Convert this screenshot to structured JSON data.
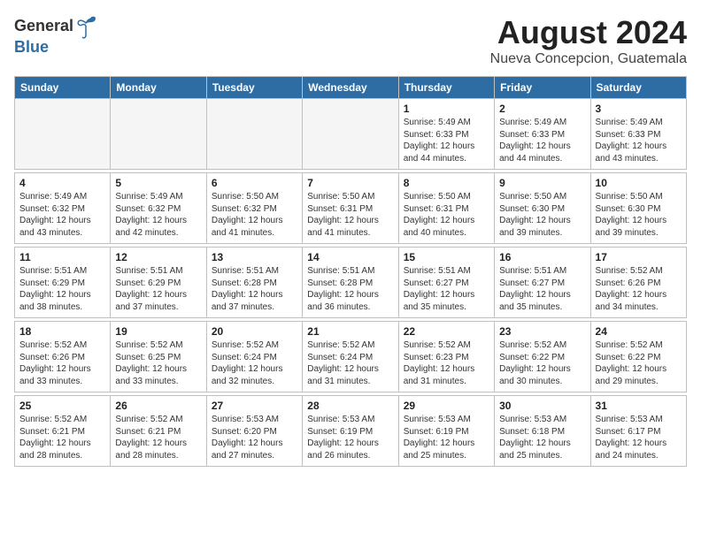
{
  "header": {
    "logo_general": "General",
    "logo_blue": "Blue",
    "month_year": "August 2024",
    "location": "Nueva Concepcion, Guatemala"
  },
  "days_of_week": [
    "Sunday",
    "Monday",
    "Tuesday",
    "Wednesday",
    "Thursday",
    "Friday",
    "Saturday"
  ],
  "weeks": [
    [
      {
        "day": "",
        "info": ""
      },
      {
        "day": "",
        "info": ""
      },
      {
        "day": "",
        "info": ""
      },
      {
        "day": "",
        "info": ""
      },
      {
        "day": "1",
        "info": "Sunrise: 5:49 AM\nSunset: 6:33 PM\nDaylight: 12 hours\nand 44 minutes."
      },
      {
        "day": "2",
        "info": "Sunrise: 5:49 AM\nSunset: 6:33 PM\nDaylight: 12 hours\nand 44 minutes."
      },
      {
        "day": "3",
        "info": "Sunrise: 5:49 AM\nSunset: 6:33 PM\nDaylight: 12 hours\nand 43 minutes."
      }
    ],
    [
      {
        "day": "4",
        "info": "Sunrise: 5:49 AM\nSunset: 6:32 PM\nDaylight: 12 hours\nand 43 minutes."
      },
      {
        "day": "5",
        "info": "Sunrise: 5:49 AM\nSunset: 6:32 PM\nDaylight: 12 hours\nand 42 minutes."
      },
      {
        "day": "6",
        "info": "Sunrise: 5:50 AM\nSunset: 6:32 PM\nDaylight: 12 hours\nand 41 minutes."
      },
      {
        "day": "7",
        "info": "Sunrise: 5:50 AM\nSunset: 6:31 PM\nDaylight: 12 hours\nand 41 minutes."
      },
      {
        "day": "8",
        "info": "Sunrise: 5:50 AM\nSunset: 6:31 PM\nDaylight: 12 hours\nand 40 minutes."
      },
      {
        "day": "9",
        "info": "Sunrise: 5:50 AM\nSunset: 6:30 PM\nDaylight: 12 hours\nand 39 minutes."
      },
      {
        "day": "10",
        "info": "Sunrise: 5:50 AM\nSunset: 6:30 PM\nDaylight: 12 hours\nand 39 minutes."
      }
    ],
    [
      {
        "day": "11",
        "info": "Sunrise: 5:51 AM\nSunset: 6:29 PM\nDaylight: 12 hours\nand 38 minutes."
      },
      {
        "day": "12",
        "info": "Sunrise: 5:51 AM\nSunset: 6:29 PM\nDaylight: 12 hours\nand 37 minutes."
      },
      {
        "day": "13",
        "info": "Sunrise: 5:51 AM\nSunset: 6:28 PM\nDaylight: 12 hours\nand 37 minutes."
      },
      {
        "day": "14",
        "info": "Sunrise: 5:51 AM\nSunset: 6:28 PM\nDaylight: 12 hours\nand 36 minutes."
      },
      {
        "day": "15",
        "info": "Sunrise: 5:51 AM\nSunset: 6:27 PM\nDaylight: 12 hours\nand 35 minutes."
      },
      {
        "day": "16",
        "info": "Sunrise: 5:51 AM\nSunset: 6:27 PM\nDaylight: 12 hours\nand 35 minutes."
      },
      {
        "day": "17",
        "info": "Sunrise: 5:52 AM\nSunset: 6:26 PM\nDaylight: 12 hours\nand 34 minutes."
      }
    ],
    [
      {
        "day": "18",
        "info": "Sunrise: 5:52 AM\nSunset: 6:26 PM\nDaylight: 12 hours\nand 33 minutes."
      },
      {
        "day": "19",
        "info": "Sunrise: 5:52 AM\nSunset: 6:25 PM\nDaylight: 12 hours\nand 33 minutes."
      },
      {
        "day": "20",
        "info": "Sunrise: 5:52 AM\nSunset: 6:24 PM\nDaylight: 12 hours\nand 32 minutes."
      },
      {
        "day": "21",
        "info": "Sunrise: 5:52 AM\nSunset: 6:24 PM\nDaylight: 12 hours\nand 31 minutes."
      },
      {
        "day": "22",
        "info": "Sunrise: 5:52 AM\nSunset: 6:23 PM\nDaylight: 12 hours\nand 31 minutes."
      },
      {
        "day": "23",
        "info": "Sunrise: 5:52 AM\nSunset: 6:22 PM\nDaylight: 12 hours\nand 30 minutes."
      },
      {
        "day": "24",
        "info": "Sunrise: 5:52 AM\nSunset: 6:22 PM\nDaylight: 12 hours\nand 29 minutes."
      }
    ],
    [
      {
        "day": "25",
        "info": "Sunrise: 5:52 AM\nSunset: 6:21 PM\nDaylight: 12 hours\nand 28 minutes."
      },
      {
        "day": "26",
        "info": "Sunrise: 5:52 AM\nSunset: 6:21 PM\nDaylight: 12 hours\nand 28 minutes."
      },
      {
        "day": "27",
        "info": "Sunrise: 5:53 AM\nSunset: 6:20 PM\nDaylight: 12 hours\nand 27 minutes."
      },
      {
        "day": "28",
        "info": "Sunrise: 5:53 AM\nSunset: 6:19 PM\nDaylight: 12 hours\nand 26 minutes."
      },
      {
        "day": "29",
        "info": "Sunrise: 5:53 AM\nSunset: 6:19 PM\nDaylight: 12 hours\nand 25 minutes."
      },
      {
        "day": "30",
        "info": "Sunrise: 5:53 AM\nSunset: 6:18 PM\nDaylight: 12 hours\nand 25 minutes."
      },
      {
        "day": "31",
        "info": "Sunrise: 5:53 AM\nSunset: 6:17 PM\nDaylight: 12 hours\nand 24 minutes."
      }
    ]
  ]
}
